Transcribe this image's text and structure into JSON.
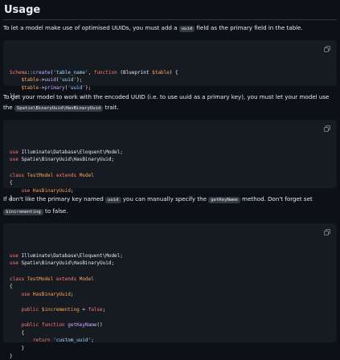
{
  "heading": "Usage",
  "para1": {
    "before": "To let a model make use of optimised UUIDs, you must add a ",
    "code": "uuid",
    "after": " field as the primary field in the table."
  },
  "code1": [
    [
      [
        "kw",
        "Schema"
      ],
      [
        "plain",
        "::"
      ],
      [
        "fn",
        "create"
      ],
      [
        "plain",
        "("
      ],
      [
        "str",
        "'table_name'"
      ],
      [
        "plain",
        ", "
      ],
      [
        "kw",
        "function"
      ],
      [
        "plain",
        " (Blueprint "
      ],
      [
        "var",
        "$table"
      ],
      [
        "plain",
        ") {"
      ]
    ],
    [
      [
        "plain",
        "    "
      ],
      [
        "var",
        "$table"
      ],
      [
        "plain",
        "->"
      ],
      [
        "fn",
        "uuid"
      ],
      [
        "plain",
        "("
      ],
      [
        "str",
        "'uuid'"
      ],
      [
        "plain",
        ");"
      ]
    ],
    [
      [
        "plain",
        "    "
      ],
      [
        "var",
        "$table"
      ],
      [
        "plain",
        "->"
      ],
      [
        "fn",
        "primary"
      ],
      [
        "plain",
        "("
      ],
      [
        "str",
        "'uuid'"
      ],
      [
        "plain",
        ");"
      ]
    ],
    [
      [
        "plain",
        "});"
      ]
    ]
  ],
  "para2": {
    "before": "To get your model to work with the encoded UUID (i.e. to use uuid as a primary key), you must let your model use the ",
    "code": "Spatie\\BinaryUuid\\HasBinaryUuid",
    "after": " trait."
  },
  "code2": [
    [
      [
        "kw",
        "use"
      ],
      [
        "plain",
        " Illuminate\\Database\\Eloquent\\Model;"
      ]
    ],
    [
      [
        "kw",
        "use"
      ],
      [
        "plain",
        " Spatie\\BinaryUuid\\HasBinaryUuid;"
      ]
    ],
    [
      [
        "plain",
        ""
      ]
    ],
    [
      [
        "kw",
        "class"
      ],
      [
        "plain",
        " "
      ],
      [
        "cls",
        "TestModel"
      ],
      [
        "plain",
        " "
      ],
      [
        "kw",
        "extends"
      ],
      [
        "plain",
        " "
      ],
      [
        "cls",
        "Model"
      ]
    ],
    [
      [
        "plain",
        "{"
      ]
    ],
    [
      [
        "plain",
        "    "
      ],
      [
        "kw",
        "use"
      ],
      [
        "plain",
        " "
      ],
      [
        "cls",
        "HasBinaryUuid"
      ],
      [
        "plain",
        ";"
      ]
    ],
    [
      [
        "plain",
        "}"
      ]
    ]
  ],
  "para3": {
    "t1": "If don't like the primary key named ",
    "c1": "uuid",
    "t2": " you can manually specify the ",
    "c2": "getKeyName",
    "t3": " method. Don't forget set ",
    "c3": "$incrementing",
    "t4": " to false."
  },
  "code3": [
    [
      [
        "kw",
        "use"
      ],
      [
        "plain",
        " Illuminate\\Database\\Eloquent\\Model;"
      ]
    ],
    [
      [
        "kw",
        "use"
      ],
      [
        "plain",
        " Spatie\\BinaryUuid\\HasBinaryUuid;"
      ]
    ],
    [
      [
        "plain",
        ""
      ]
    ],
    [
      [
        "kw",
        "class"
      ],
      [
        "plain",
        " "
      ],
      [
        "cls",
        "TestModel"
      ],
      [
        "plain",
        " "
      ],
      [
        "kw",
        "extends"
      ],
      [
        "plain",
        " "
      ],
      [
        "cls",
        "Model"
      ]
    ],
    [
      [
        "plain",
        "{"
      ]
    ],
    [
      [
        "plain",
        "    "
      ],
      [
        "kw",
        "use"
      ],
      [
        "plain",
        " "
      ],
      [
        "cls",
        "HasBinaryUuid"
      ],
      [
        "plain",
        ";"
      ]
    ],
    [
      [
        "plain",
        ""
      ]
    ],
    [
      [
        "plain",
        "    "
      ],
      [
        "kw",
        "public"
      ],
      [
        "plain",
        " "
      ],
      [
        "var",
        "$incrementing"
      ],
      [
        "plain",
        " = "
      ],
      [
        "kw",
        "false"
      ],
      [
        "plain",
        ";"
      ]
    ],
    [
      [
        "plain",
        ""
      ]
    ],
    [
      [
        "plain",
        "    "
      ],
      [
        "kw",
        "public"
      ],
      [
        "plain",
        " "
      ],
      [
        "kw",
        "function"
      ],
      [
        "plain",
        " "
      ],
      [
        "fn",
        "getKeyName"
      ],
      [
        "plain",
        "()"
      ]
    ],
    [
      [
        "plain",
        "    {"
      ]
    ],
    [
      [
        "plain",
        "        "
      ],
      [
        "kw",
        "return"
      ],
      [
        "plain",
        " "
      ],
      [
        "str",
        "'custom_uuid'"
      ],
      [
        "plain",
        ";"
      ]
    ],
    [
      [
        "plain",
        "    }"
      ]
    ],
    [
      [
        "plain",
        "}"
      ]
    ]
  ],
  "icons": {
    "copy": "copy-icon"
  }
}
